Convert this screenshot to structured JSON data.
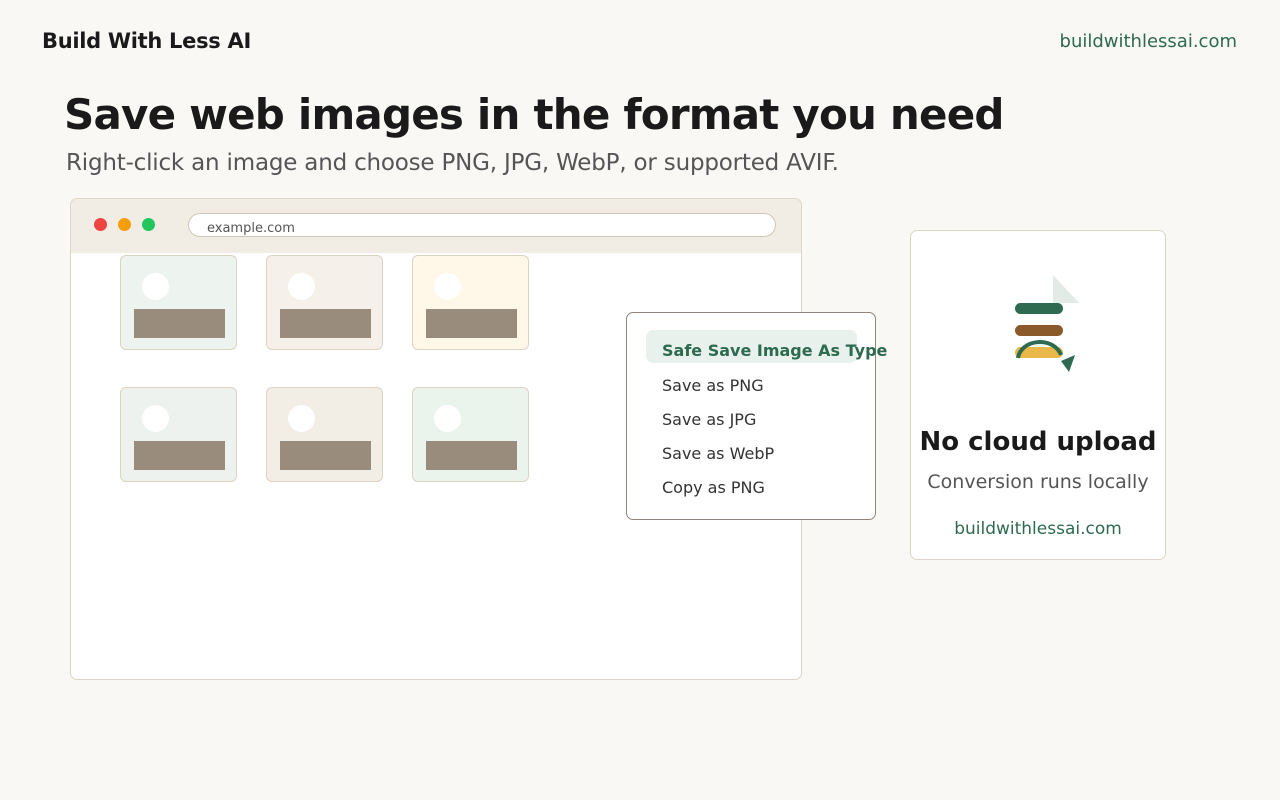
{
  "header": {
    "brand": "Build With Less AI",
    "link": "buildwithlessai.com"
  },
  "hero": {
    "title": "Save web images in the format you need",
    "subtitle": "Right-click an image and choose PNG, JPG, WebP, or supported AVIF."
  },
  "browser": {
    "address": "example.com",
    "image_tiles": [
      {
        "bg": "#edf3ef"
      },
      {
        "bg": "#f5f1ea"
      },
      {
        "bg": "#fff8e8"
      },
      {
        "bg": "#eef2ee"
      },
      {
        "bg": "#f2ede5"
      },
      {
        "bg": "#eaf3ec"
      }
    ]
  },
  "context_menu": {
    "title": "Safe Save Image As Type",
    "items": [
      "Save as PNG",
      "Save as JPG",
      "Save as WebP",
      "Copy as PNG"
    ]
  },
  "feature_card": {
    "icon": "image-convert-icon",
    "title": "No cloud upload",
    "subtitle": "Conversion runs locally",
    "link": "buildwithlessai.com"
  },
  "colors": {
    "accent": "#2d6a4f",
    "background": "#f9f8f5",
    "icon_bars": [
      "#2d6a4f",
      "#8b5a2b",
      "#e9b84a"
    ]
  }
}
